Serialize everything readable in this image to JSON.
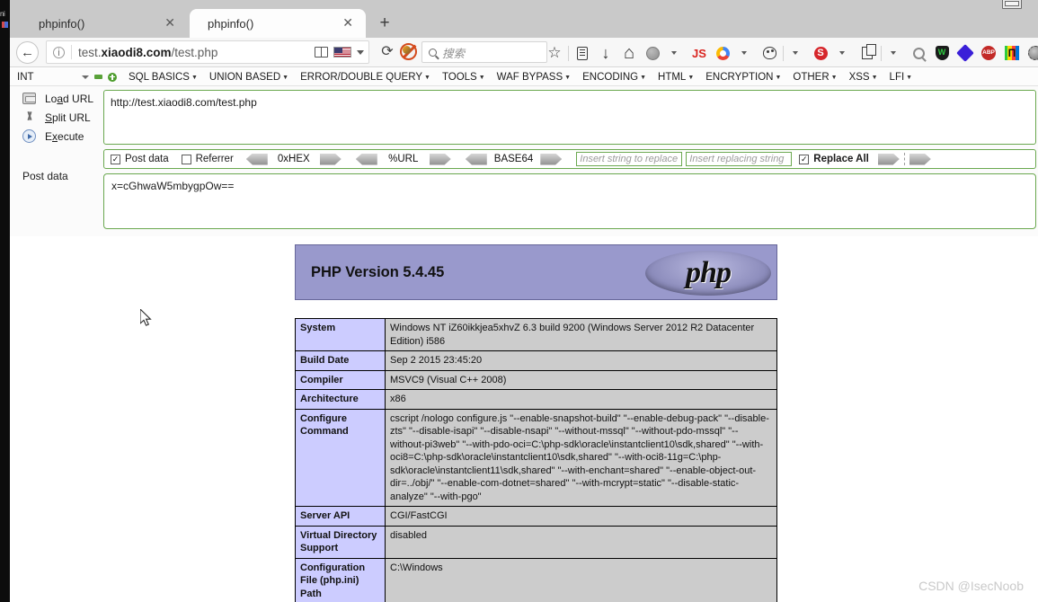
{
  "window": {
    "restore_button": "restore-window"
  },
  "browser": {
    "tabs": [
      {
        "title": "phpinfo()",
        "active": false
      },
      {
        "title": "phpinfo()",
        "active": true
      }
    ],
    "new_tab_label": "+",
    "back_label": "←",
    "address": {
      "prefix": "test.",
      "domain": "xiaodi8.com",
      "path": "/test.php",
      "info_icon": "ⓘ"
    },
    "reload_label": "⟳",
    "search": {
      "placeholder": "搜索"
    },
    "toolbar_icons": [
      "bookmark-star-icon",
      "reading-list-icon",
      "downloads-icon",
      "home-icon",
      "globe-icon",
      "javascript-toggle-icon",
      "chrome-icon",
      "palette-icon",
      "red-s-icon",
      "page-copy-icon",
      "zoom-icon",
      "wot-shield-icon",
      "diamond-icon",
      "adblock-plus-icon",
      "proxy-icon",
      "settings-gear-icon"
    ]
  },
  "hackbar": {
    "select_value": "INT",
    "menu_items": [
      "SQL BASICS",
      "UNION BASED",
      "ERROR/DOUBLE QUERY",
      "TOOLS",
      "WAF BYPASS",
      "ENCODING",
      "HTML",
      "ENCRYPTION",
      "OTHER",
      "XSS",
      "LFI"
    ],
    "actions": [
      {
        "label_pre": "Lo",
        "label_accel": "a",
        "label_post": "d URL",
        "icon": "load-url-icon"
      },
      {
        "label_pre": "",
        "label_accel": "S",
        "label_post": "plit URL",
        "icon": "split-url-icon"
      },
      {
        "label_pre": "E",
        "label_accel": "x",
        "label_post": "ecute",
        "icon": "execute-icon"
      }
    ],
    "url_value": "http://test.xiaodi8.com/test.php",
    "post_label": "Post data",
    "post_value": "x=cGhwaW5mbygpOw==",
    "options": {
      "post_data_checkbox": {
        "label": "Post data",
        "checked": true
      },
      "referrer_checkbox": {
        "label": "Referrer",
        "checked": false
      },
      "encoders": [
        "0xHEX",
        "%URL",
        "BASE64"
      ],
      "replace_find_placeholder": "Insert string to replace",
      "replace_with_placeholder": "Insert replacing string",
      "replace_all_checkbox": {
        "label": "Replace All",
        "checked": true
      }
    }
  },
  "phpinfo": {
    "version_title": "PHP Version 5.4.45",
    "logo_text": "php",
    "rows": [
      {
        "key": "System",
        "value": "Windows NT iZ60ikkjea5xhvZ 6.3 build 9200 (Windows Server 2012 R2 Datacenter Edition) i586"
      },
      {
        "key": "Build Date",
        "value": "Sep 2 2015 23:45:20"
      },
      {
        "key": "Compiler",
        "value": "MSVC9 (Visual C++ 2008)"
      },
      {
        "key": "Architecture",
        "value": "x86"
      },
      {
        "key": "Configure Command",
        "value": "cscript /nologo configure.js \"--enable-snapshot-build\" \"--enable-debug-pack\" \"--disable-zts\" \"--disable-isapi\" \"--disable-nsapi\" \"--without-mssql\" \"--without-pdo-mssql\" \"--without-pi3web\" \"--with-pdo-oci=C:\\php-sdk\\oracle\\instantclient10\\sdk,shared\" \"--with-oci8=C:\\php-sdk\\oracle\\instantclient10\\sdk,shared\" \"--with-oci8-11g=C:\\php-sdk\\oracle\\instantclient11\\sdk,shared\" \"--with-enchant=shared\" \"--enable-object-out-dir=../obj/\" \"--enable-com-dotnet=shared\" \"--with-mcrypt=static\" \"--disable-static-analyze\" \"--with-pgo\""
      },
      {
        "key": "Server API",
        "value": "CGI/FastCGI"
      },
      {
        "key": "Virtual Directory Support",
        "value": "disabled"
      },
      {
        "key": "Configuration File (php.ini) Path",
        "value": "C:\\Windows"
      }
    ]
  },
  "watermark": {
    "text": "CSDN @IsecNoob"
  },
  "colors": {
    "php_header_bg": "#9999cc",
    "table_key_bg": "#ccccff",
    "table_value_bg": "#cccccc",
    "hackbar_border": "#6aa84f"
  }
}
